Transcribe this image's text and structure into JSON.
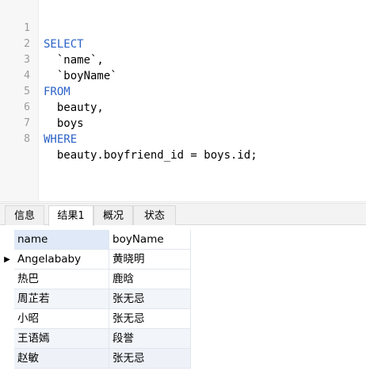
{
  "editor": {
    "lines": [
      {
        "num": "1",
        "keyword": "SELECT",
        "text": ""
      },
      {
        "num": "2",
        "keyword": "",
        "text": "  `name`,"
      },
      {
        "num": "3",
        "keyword": "",
        "text": "  `boyName`"
      },
      {
        "num": "4",
        "keyword": "FROM",
        "text": ""
      },
      {
        "num": "5",
        "keyword": "",
        "text": "  beauty,"
      },
      {
        "num": "6",
        "keyword": "",
        "text": "  boys"
      },
      {
        "num": "7",
        "keyword": "WHERE",
        "text": ""
      },
      {
        "num": "8",
        "keyword": "",
        "text": "  beauty.boyfriend_id = boys.id;"
      }
    ],
    "keyword_color": "#2b62c6"
  },
  "tabs": [
    {
      "label": "信息",
      "active": false
    },
    {
      "label": "结果1",
      "active": true
    },
    {
      "label": "概况",
      "active": false
    },
    {
      "label": "状态",
      "active": false
    }
  ],
  "results": {
    "columns": [
      "name",
      "boyName"
    ],
    "rows": [
      [
        "Angelababy",
        "黄晓明"
      ],
      [
        "热巴",
        "鹿晗"
      ],
      [
        "周芷若",
        "张无忌"
      ],
      [
        "小昭",
        "张无忌"
      ],
      [
        "王语嫣",
        "段誉"
      ],
      [
        "赵敏",
        "张无忌"
      ]
    ],
    "current_row_marker": "▶",
    "selected_header_color": "#dfe9f7"
  }
}
